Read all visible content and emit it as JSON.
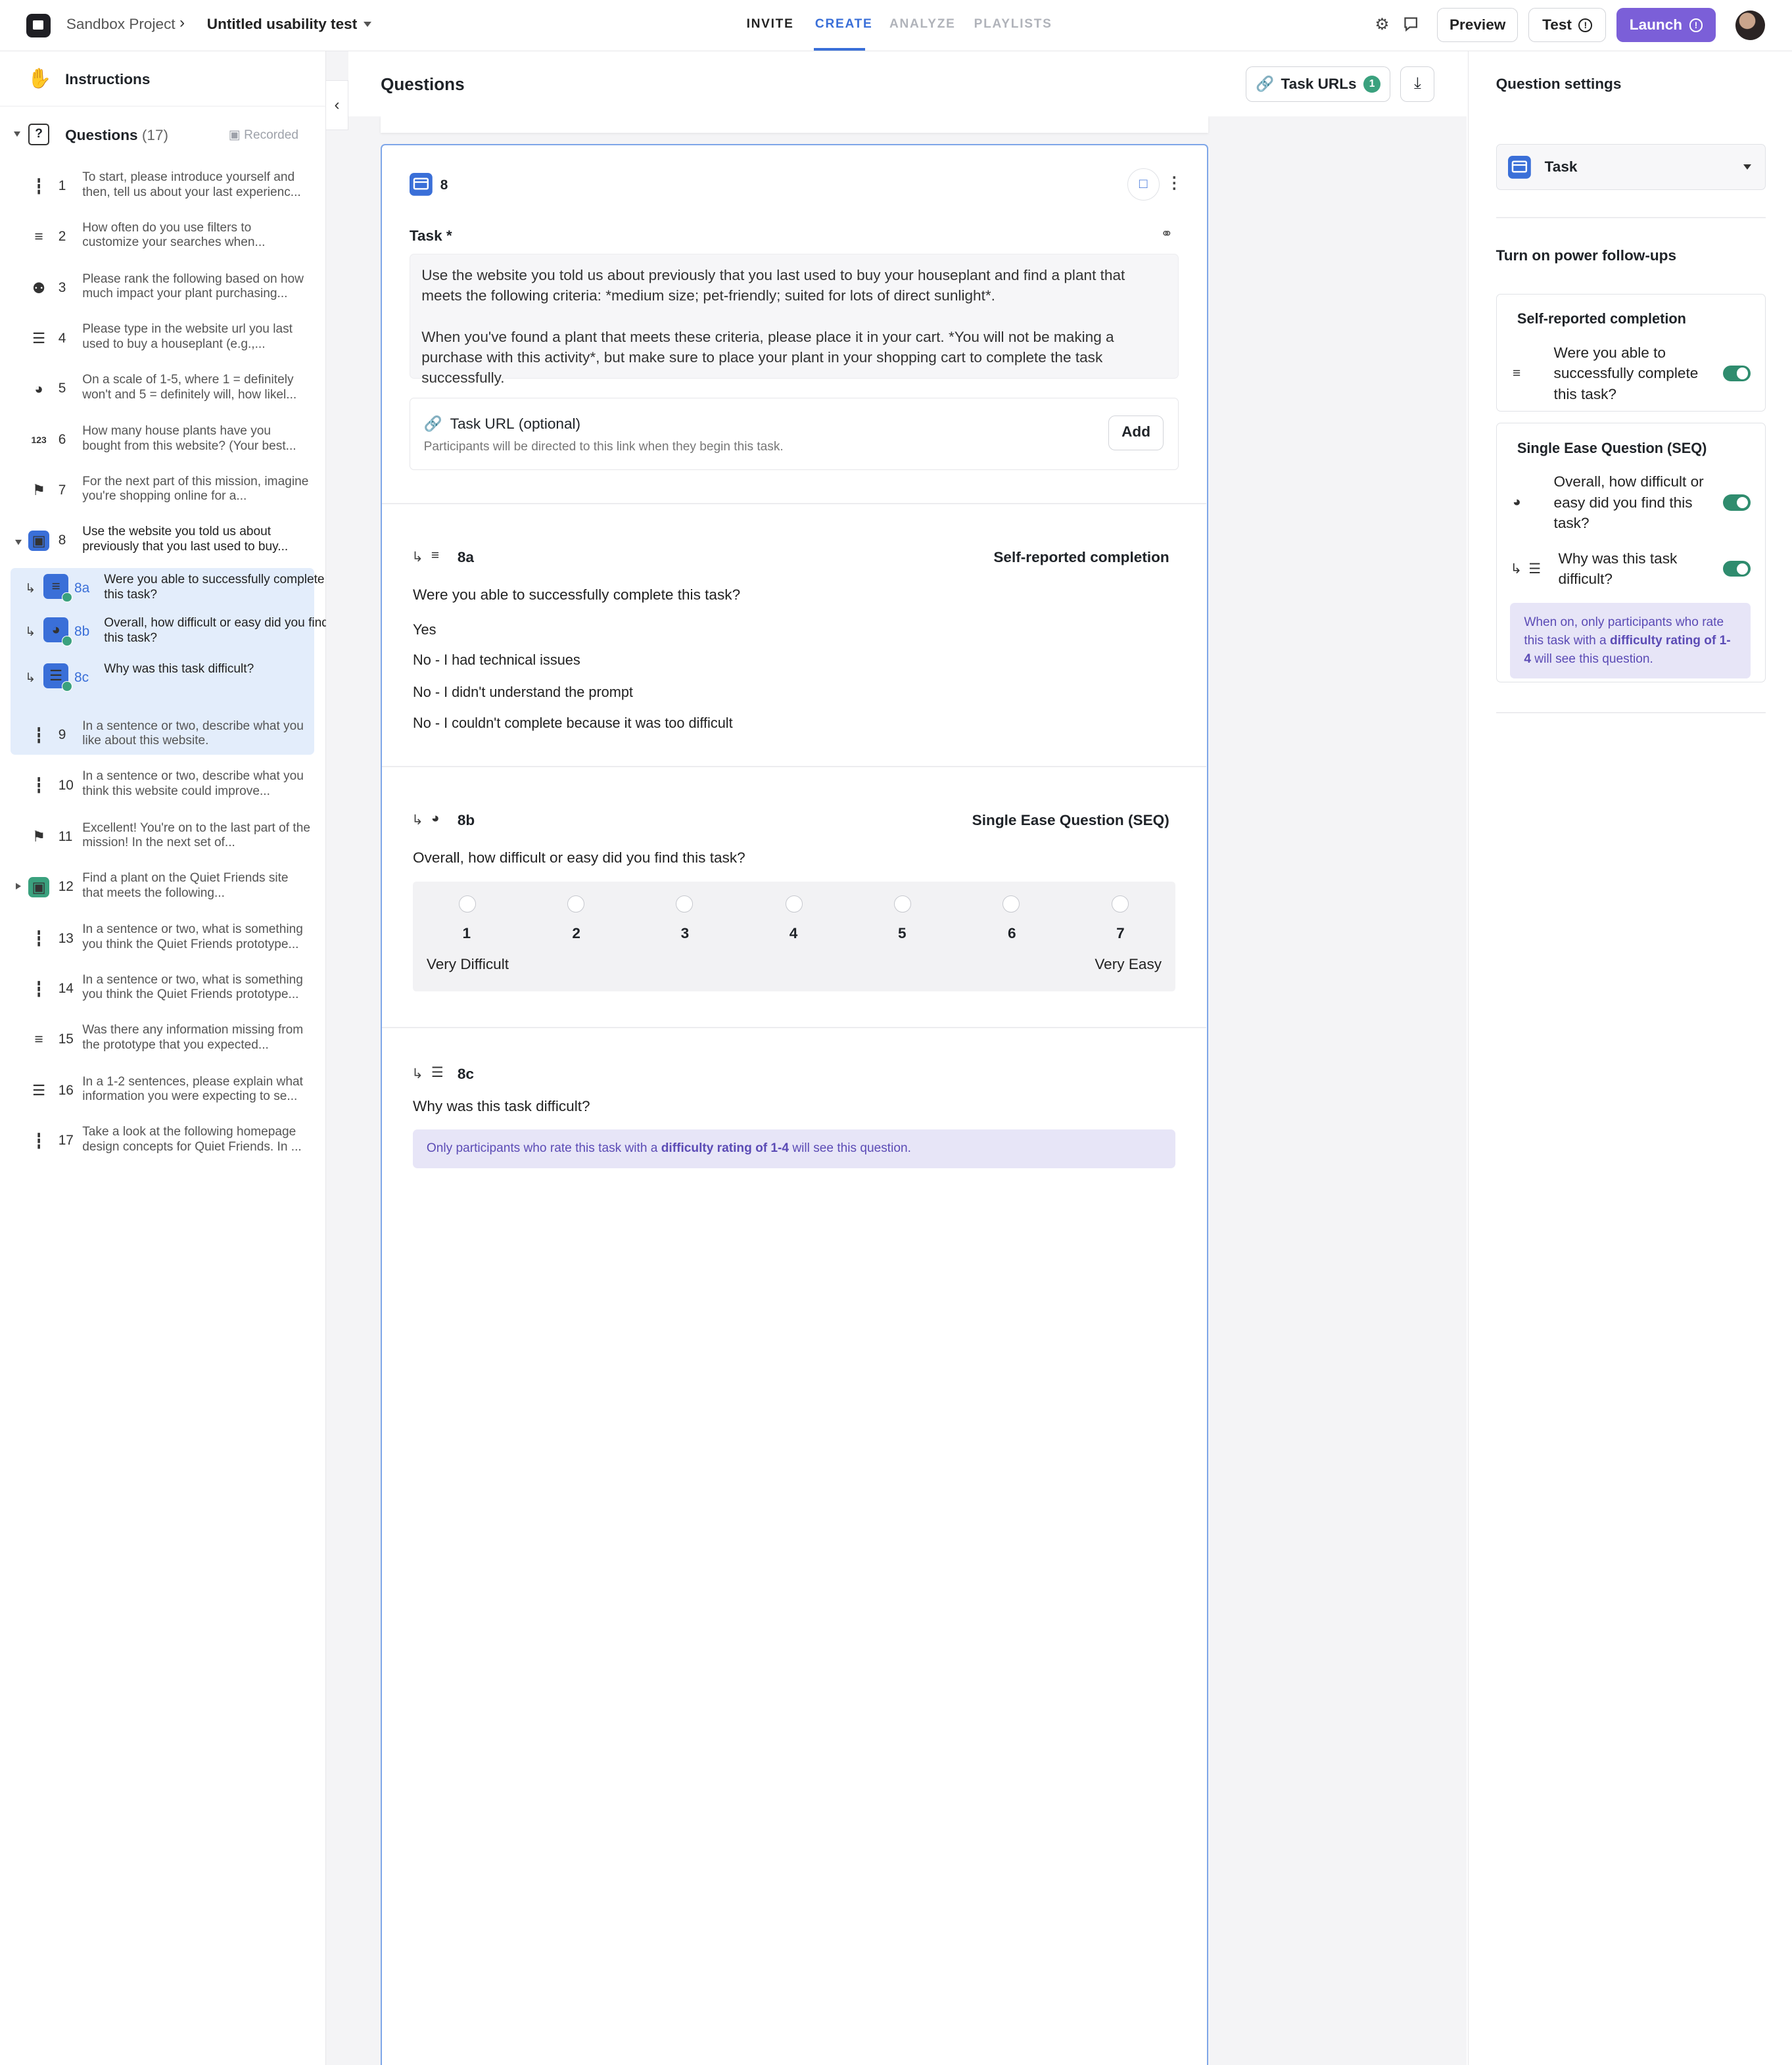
{
  "topbar": {
    "project": "Sandbox Project",
    "test_name": "Untitled usability test",
    "tabs": [
      {
        "label": "INVITE",
        "state": "normal"
      },
      {
        "label": "CREATE",
        "state": "active"
      },
      {
        "label": "ANALYZE",
        "state": "disabled"
      },
      {
        "label": "PLAYLISTS",
        "state": "disabled"
      }
    ],
    "preview_label": "Preview",
    "test_label": "Test",
    "launch_label": "Launch"
  },
  "sidebar": {
    "instructions_label": "Instructions",
    "questions_label": "Questions",
    "questions_count": "(17)",
    "recorded_label": "Recorded",
    "items": [
      {
        "num": "1",
        "icon": "audio-icon",
        "text": "To start, please introduce yourself and then, tell us about your last experienc..."
      },
      {
        "num": "2",
        "icon": "list-icon",
        "text": "How often do you use filters to customize your searches when..."
      },
      {
        "num": "3",
        "icon": "rank-icon",
        "text": "Please rank the following based on how much impact your plant purchasing..."
      },
      {
        "num": "4",
        "icon": "text-icon",
        "text": "Please type in the website url you last used to buy a houseplant (e.g.,..."
      },
      {
        "num": "5",
        "icon": "rating-icon",
        "text": "On a scale of 1-5, where 1 = definitely won't and 5 = definitely will, how likel..."
      },
      {
        "num": "6",
        "icon": "number-icon",
        "text": "How many house plants have you bought from this website? (Your best..."
      },
      {
        "num": "7",
        "icon": "flag-icon",
        "text": "For the next part of this mission, imagine you're shopping online for a..."
      },
      {
        "num": "8",
        "icon": "task-icon",
        "text": "Use the website you told us about previously that you last used to buy..."
      },
      {
        "num": "9",
        "icon": "audio-icon",
        "text": "In a sentence or two, describe what you like about this website."
      },
      {
        "num": "10",
        "icon": "audio-icon",
        "text": "In a sentence or two, describe what you think this website could improve..."
      },
      {
        "num": "11",
        "icon": "flag-icon",
        "text": "Excellent! You're on to the last part of the mission! In the next set of..."
      },
      {
        "num": "12",
        "icon": "task-icon",
        "text": "Find a plant on the Quiet Friends site that meets the following..."
      },
      {
        "num": "13",
        "icon": "audio-icon",
        "text": "In a sentence or two, what is something you think the Quiet Friends prototype..."
      },
      {
        "num": "14",
        "icon": "audio-icon",
        "text": "In a sentence or two, what is something you think the Quiet Friends prototype..."
      },
      {
        "num": "15",
        "icon": "list-icon",
        "text": "Was there any information missing from the prototype that you expected..."
      },
      {
        "num": "16",
        "icon": "text-icon",
        "text": "In a 1-2 sentences, please explain what information you were expecting to se..."
      },
      {
        "num": "17",
        "icon": "audio-icon",
        "text": "Take a look at the following homepage design concepts for Quiet Friends. In ..."
      }
    ],
    "subitems": [
      {
        "num": "8a",
        "text": "Were you able to successfully complete this task?"
      },
      {
        "num": "8b",
        "text": "Overall, how difficult or easy did you find this task?"
      },
      {
        "num": "8c",
        "text": "Why was this task difficult?"
      }
    ]
  },
  "main": {
    "title": "Questions",
    "task_urls_label": "Task URLs",
    "task_urls_count": "1",
    "question": {
      "num": "8",
      "task_label": "Task *",
      "task_text_1": "Use the website you told us about previously that you last used to buy your houseplant and find a plant that meets the following criteria: *medium size; pet-friendly; suited for lots of direct sunlight*.",
      "task_text_2": "When you've found a plant that meets these criteria, please place it in your cart. *You will not be making a purchase with this activity*, but make sure to place your plant in your shopping cart to complete the task successfully.",
      "url_label": "Task URL",
      "url_optional": "(optional)",
      "url_desc": "Participants will be directed to this link when they begin this task.",
      "add_label": "Add"
    },
    "followups": {
      "a": {
        "num": "8a",
        "type": "Self-reported completion",
        "question": "Were you able to successfully complete this task?",
        "options": [
          "Yes",
          "No - I had technical issues",
          "No - I didn't understand the prompt",
          "No - I couldn't complete because it was too difficult"
        ]
      },
      "b": {
        "num": "8b",
        "type": "Single Ease Question (SEQ)",
        "question": "Overall, how difficult or easy did you find this task?",
        "scale": [
          "1",
          "2",
          "3",
          "4",
          "5",
          "6",
          "7"
        ],
        "low_label": "Very Difficult",
        "high_label": "Very Easy"
      },
      "c": {
        "num": "8c",
        "question": "Why was this task difficult?",
        "note_pre": "Only participants who rate this task with a",
        "note_bold": "difficulty rating of 1-4",
        "note_post": "will see this question."
      }
    }
  },
  "settings": {
    "title": "Question settings",
    "type_label": "Task",
    "power_title": "Turn on power follow-ups",
    "panel1_title": "Self-reported completion",
    "panel1_item": "Were you able to successfully complete this task?",
    "panel2_title": "Single Ease Question (SEQ)",
    "panel2_item1": "Overall, how difficult or easy did you find this task?",
    "panel2_item2": "Why was this task difficult?",
    "note_pre": "When on, only participants who rate this task with a",
    "note_bold": "difficulty rating of 1-4",
    "note_post": "will see this question."
  },
  "colors": {
    "accent": "#3a6fd8",
    "launch": "#7b5fd8",
    "toggle": "#2f8c6e",
    "selected_bg": "#e3edfb"
  }
}
